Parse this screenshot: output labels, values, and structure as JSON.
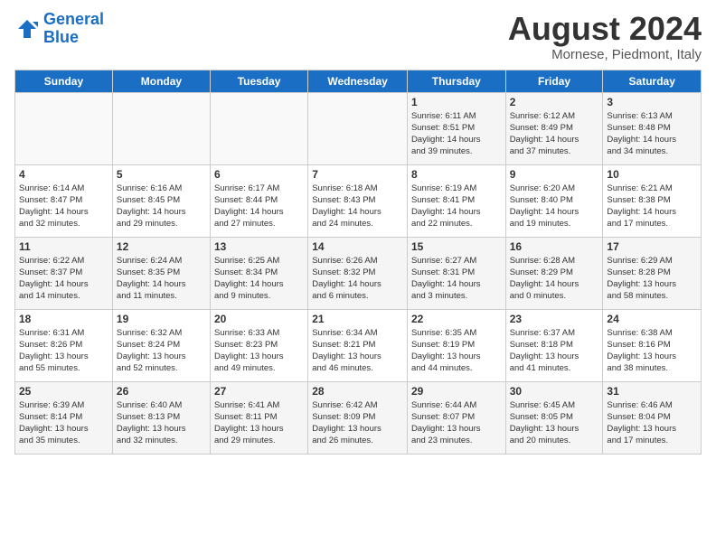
{
  "logo": {
    "line1": "General",
    "line2": "Blue"
  },
  "title": "August 2024",
  "location": "Mornese, Piedmont, Italy",
  "weekdays": [
    "Sunday",
    "Monday",
    "Tuesday",
    "Wednesday",
    "Thursday",
    "Friday",
    "Saturday"
  ],
  "weeks": [
    [
      {
        "day": "",
        "info": ""
      },
      {
        "day": "",
        "info": ""
      },
      {
        "day": "",
        "info": ""
      },
      {
        "day": "",
        "info": ""
      },
      {
        "day": "1",
        "info": "Sunrise: 6:11 AM\nSunset: 8:51 PM\nDaylight: 14 hours\nand 39 minutes."
      },
      {
        "day": "2",
        "info": "Sunrise: 6:12 AM\nSunset: 8:49 PM\nDaylight: 14 hours\nand 37 minutes."
      },
      {
        "day": "3",
        "info": "Sunrise: 6:13 AM\nSunset: 8:48 PM\nDaylight: 14 hours\nand 34 minutes."
      }
    ],
    [
      {
        "day": "4",
        "info": "Sunrise: 6:14 AM\nSunset: 8:47 PM\nDaylight: 14 hours\nand 32 minutes."
      },
      {
        "day": "5",
        "info": "Sunrise: 6:16 AM\nSunset: 8:45 PM\nDaylight: 14 hours\nand 29 minutes."
      },
      {
        "day": "6",
        "info": "Sunrise: 6:17 AM\nSunset: 8:44 PM\nDaylight: 14 hours\nand 27 minutes."
      },
      {
        "day": "7",
        "info": "Sunrise: 6:18 AM\nSunset: 8:43 PM\nDaylight: 14 hours\nand 24 minutes."
      },
      {
        "day": "8",
        "info": "Sunrise: 6:19 AM\nSunset: 8:41 PM\nDaylight: 14 hours\nand 22 minutes."
      },
      {
        "day": "9",
        "info": "Sunrise: 6:20 AM\nSunset: 8:40 PM\nDaylight: 14 hours\nand 19 minutes."
      },
      {
        "day": "10",
        "info": "Sunrise: 6:21 AM\nSunset: 8:38 PM\nDaylight: 14 hours\nand 17 minutes."
      }
    ],
    [
      {
        "day": "11",
        "info": "Sunrise: 6:22 AM\nSunset: 8:37 PM\nDaylight: 14 hours\nand 14 minutes."
      },
      {
        "day": "12",
        "info": "Sunrise: 6:24 AM\nSunset: 8:35 PM\nDaylight: 14 hours\nand 11 minutes."
      },
      {
        "day": "13",
        "info": "Sunrise: 6:25 AM\nSunset: 8:34 PM\nDaylight: 14 hours\nand 9 minutes."
      },
      {
        "day": "14",
        "info": "Sunrise: 6:26 AM\nSunset: 8:32 PM\nDaylight: 14 hours\nand 6 minutes."
      },
      {
        "day": "15",
        "info": "Sunrise: 6:27 AM\nSunset: 8:31 PM\nDaylight: 14 hours\nand 3 minutes."
      },
      {
        "day": "16",
        "info": "Sunrise: 6:28 AM\nSunset: 8:29 PM\nDaylight: 14 hours\nand 0 minutes."
      },
      {
        "day": "17",
        "info": "Sunrise: 6:29 AM\nSunset: 8:28 PM\nDaylight: 13 hours\nand 58 minutes."
      }
    ],
    [
      {
        "day": "18",
        "info": "Sunrise: 6:31 AM\nSunset: 8:26 PM\nDaylight: 13 hours\nand 55 minutes."
      },
      {
        "day": "19",
        "info": "Sunrise: 6:32 AM\nSunset: 8:24 PM\nDaylight: 13 hours\nand 52 minutes."
      },
      {
        "day": "20",
        "info": "Sunrise: 6:33 AM\nSunset: 8:23 PM\nDaylight: 13 hours\nand 49 minutes."
      },
      {
        "day": "21",
        "info": "Sunrise: 6:34 AM\nSunset: 8:21 PM\nDaylight: 13 hours\nand 46 minutes."
      },
      {
        "day": "22",
        "info": "Sunrise: 6:35 AM\nSunset: 8:19 PM\nDaylight: 13 hours\nand 44 minutes."
      },
      {
        "day": "23",
        "info": "Sunrise: 6:37 AM\nSunset: 8:18 PM\nDaylight: 13 hours\nand 41 minutes."
      },
      {
        "day": "24",
        "info": "Sunrise: 6:38 AM\nSunset: 8:16 PM\nDaylight: 13 hours\nand 38 minutes."
      }
    ],
    [
      {
        "day": "25",
        "info": "Sunrise: 6:39 AM\nSunset: 8:14 PM\nDaylight: 13 hours\nand 35 minutes."
      },
      {
        "day": "26",
        "info": "Sunrise: 6:40 AM\nSunset: 8:13 PM\nDaylight: 13 hours\nand 32 minutes."
      },
      {
        "day": "27",
        "info": "Sunrise: 6:41 AM\nSunset: 8:11 PM\nDaylight: 13 hours\nand 29 minutes."
      },
      {
        "day": "28",
        "info": "Sunrise: 6:42 AM\nSunset: 8:09 PM\nDaylight: 13 hours\nand 26 minutes."
      },
      {
        "day": "29",
        "info": "Sunrise: 6:44 AM\nSunset: 8:07 PM\nDaylight: 13 hours\nand 23 minutes."
      },
      {
        "day": "30",
        "info": "Sunrise: 6:45 AM\nSunset: 8:05 PM\nDaylight: 13 hours\nand 20 minutes."
      },
      {
        "day": "31",
        "info": "Sunrise: 6:46 AM\nSunset: 8:04 PM\nDaylight: 13 hours\nand 17 minutes."
      }
    ]
  ]
}
